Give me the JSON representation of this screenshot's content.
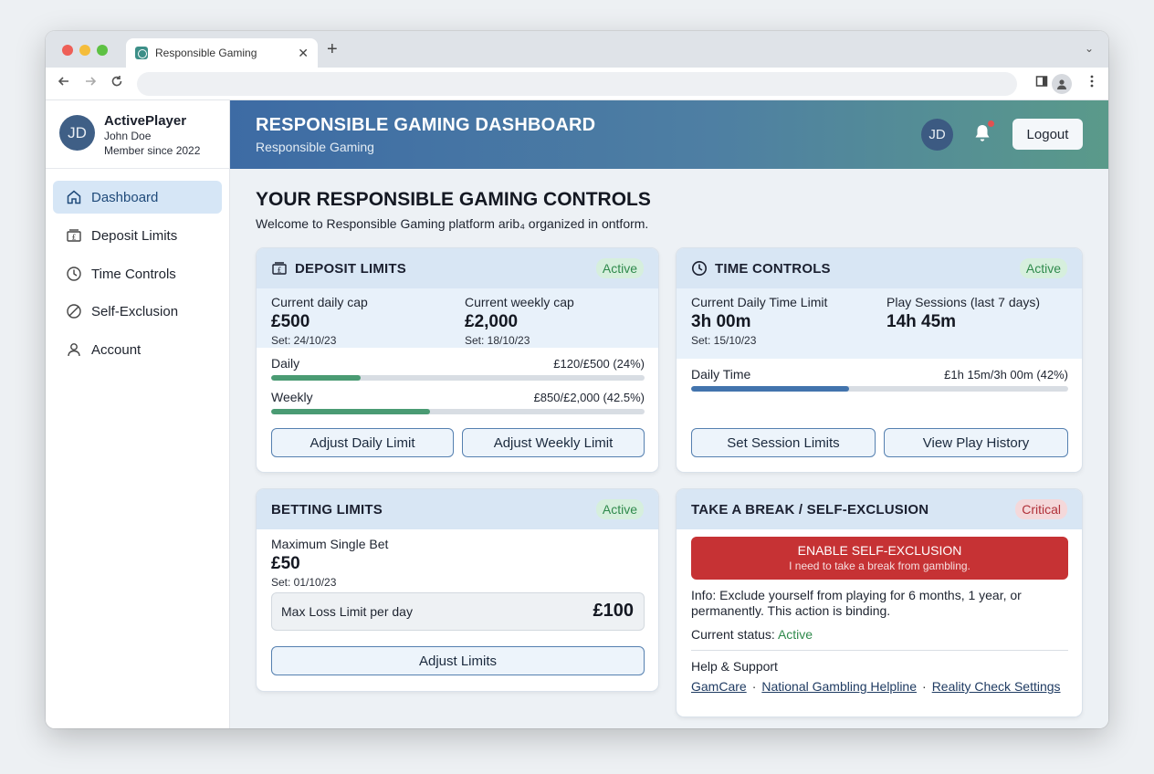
{
  "browser": {
    "tab_title": "Responsible Gaming",
    "tab_close": "✕",
    "new_tab": "+",
    "tab_menu": "⌄",
    "address": ""
  },
  "sidebar": {
    "user": {
      "initials": "JD",
      "username": "ActivePlayer",
      "full_name": "John Doe",
      "member_since": "Member since 2022"
    },
    "items": [
      {
        "label": "Dashboard",
        "icon": "home-icon",
        "active": true
      },
      {
        "label": "Deposit Limits",
        "icon": "deposit-icon"
      },
      {
        "label": "Time Controls",
        "icon": "clock-icon"
      },
      {
        "label": "Self-Exclusion",
        "icon": "block-icon"
      },
      {
        "label": "Account",
        "icon": "user-icon"
      }
    ]
  },
  "header": {
    "title": "RESPONSIBLE GAMING DASHBOARD",
    "subtitle": "Responsible Gaming",
    "avatar": "JD",
    "logout": "Logout"
  },
  "main": {
    "title": "YOUR RESPONSIBLE GAMING CONTROLS",
    "subtitle": "Welcome to Responsible Gaming platform arib₄ organized in ontform."
  },
  "deposit": {
    "title": "DEPOSIT LIMITS",
    "badge": "Active",
    "daily_label": "Current daily cap",
    "daily_value": "£500",
    "daily_set": "Set: 24/10/23",
    "weekly_label": "Current weekly cap",
    "weekly_value": "£2,000",
    "weekly_set": "Set: 18/10/23",
    "progress": [
      {
        "label": "Daily",
        "text": "£120/£500 (24%)",
        "fraction": 0.24
      },
      {
        "label": "Weekly",
        "text": "£850/£2,000 (42.5%)",
        "fraction": 0.425
      }
    ],
    "btn_daily": "Adjust Daily Limit",
    "btn_weekly": "Adjust Weekly Limit"
  },
  "time": {
    "title": "TIME CONTROLS",
    "badge": "Active",
    "limit_label": "Current Daily Time Limit",
    "limit_value": "3h 00m",
    "limit_set": "Set: 15/10/23",
    "sessions_label": "Play Sessions (last 7 days)",
    "sessions_value": "14h 45m",
    "progress_label": "Daily Time",
    "progress_text": "£1h 15m/3h 00m (42%)",
    "progress_fraction": 0.42,
    "btn_session": "Set Session Limits",
    "btn_history": "View Play History"
  },
  "betting": {
    "title": "BETTING LIMITS",
    "badge": "Active",
    "max_label": "Maximum Single Bet",
    "max_value": "£50",
    "max_set": "Set: 01/10/23",
    "loss_label": "Max Loss Limit per day",
    "loss_value": "£100",
    "btn_adjust": "Adjust Limits"
  },
  "selfexcl": {
    "title": "TAKE A BREAK / SELF-EXCLUSION",
    "badge": "Critical",
    "btn_main": "ENABLE SELF-EXCLUSION",
    "btn_sub": "I need to take a break from gambling.",
    "info": "Info: Exclude yourself from playing for 6 months, 1 year, or permanently. This action is binding.",
    "status_label": "Current status:",
    "status_value": "Active",
    "help": "Help & Support",
    "links": [
      "GamCare",
      "National Gambling Helpline",
      "Reality Check Settings"
    ],
    "link_sep": "·"
  },
  "colors": {
    "accent": "#3d6ba4",
    "progress_green": "#4a9b73",
    "progress_blue": "#4274ad",
    "critical": "#c63234",
    "active_green": "#2f8a4c"
  }
}
